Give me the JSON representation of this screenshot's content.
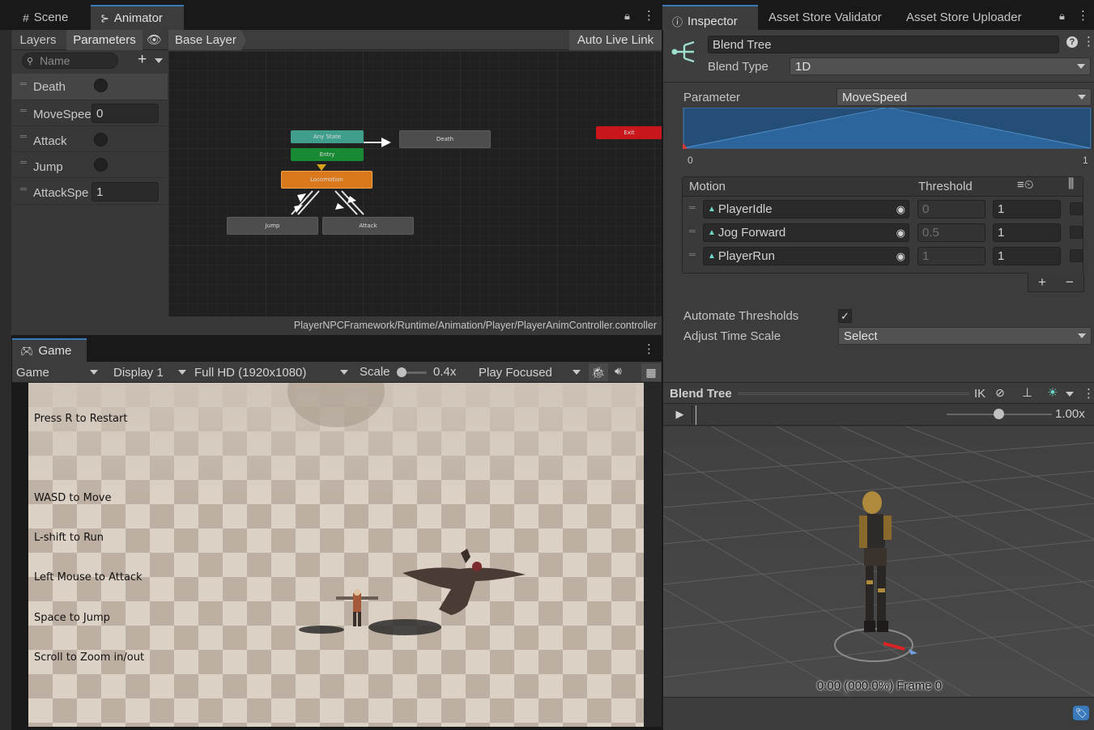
{
  "left_tabs": {
    "scene": "Scene",
    "animator": "Animator"
  },
  "animator": {
    "subtabs": {
      "layers": "Layers",
      "parameters": "Parameters"
    },
    "breadcrumb": "Base Layer",
    "auto_live_link": "Auto Live Link",
    "search_placeholder": "Name",
    "parameters": [
      {
        "name": "Death",
        "type": "trigger"
      },
      {
        "name": "MoveSpee",
        "type": "float",
        "value": "0"
      },
      {
        "name": "Attack",
        "type": "trigger"
      },
      {
        "name": "Jump",
        "type": "trigger"
      },
      {
        "name": "AttackSpe",
        "type": "float",
        "value": "1"
      }
    ],
    "nodes": {
      "any_state": "Any State",
      "entry": "Entry",
      "locomotion": "Locomotion",
      "death": "Death",
      "exit": "Exit",
      "jump": "Jump",
      "attack": "Attack"
    },
    "footer_path": "PlayerNPCFramework/Runtime/Animation/Player/PlayerAnimController.controller"
  },
  "game": {
    "tab": "Game",
    "toolbar": {
      "mode": "Game",
      "display": "Display 1",
      "resolution": "Full HD (1920x1080)",
      "scale_label": "Scale",
      "scale_value": "0.4x",
      "play_mode": "Play Focused"
    },
    "hints": {
      "restart": "Press R to Restart",
      "move": "WASD to Move",
      "run": "L-shift to Run",
      "attack": "Left Mouse to Attack",
      "jump": "Space to Jump",
      "zoom": "Scroll to Zoom in/out"
    }
  },
  "right_tabs": {
    "inspector": "Inspector",
    "validator": "Asset Store Validator",
    "uploader": "Asset Store Uploader"
  },
  "inspector": {
    "object_name": "Blend Tree",
    "blend_type_label": "Blend Type",
    "blend_type": "1D",
    "parameter_label": "Parameter",
    "parameter_value": "MoveSpeed",
    "graph_min": "0",
    "graph_max": "1",
    "motion_header": "Motion",
    "threshold_header": "Threshold",
    "motions": [
      {
        "name": "PlayerIdle",
        "threshold": "0",
        "speed": "1"
      },
      {
        "name": "Jog Forward",
        "threshold": "0.5",
        "speed": "1"
      },
      {
        "name": "PlayerRun",
        "threshold": "1",
        "speed": "1"
      }
    ],
    "add_label": "+",
    "remove_label": "−",
    "automate_thresholds_label": "Automate Thresholds",
    "adjust_time_scale_label": "Adjust Time Scale",
    "adjust_time_scale_value": "Select"
  },
  "preview": {
    "title": "Blend Tree",
    "ik_label": "IK",
    "speed": "1.00x",
    "status": "0:00 (000.0%) Frame 0"
  },
  "colors": {
    "accent": "#3a79bb",
    "any_state": "#3f9e8c",
    "entry": "#178a33",
    "locomotion": "#d9791c",
    "exit": "#c8161c",
    "blend_fill": "#2e6ea8"
  }
}
